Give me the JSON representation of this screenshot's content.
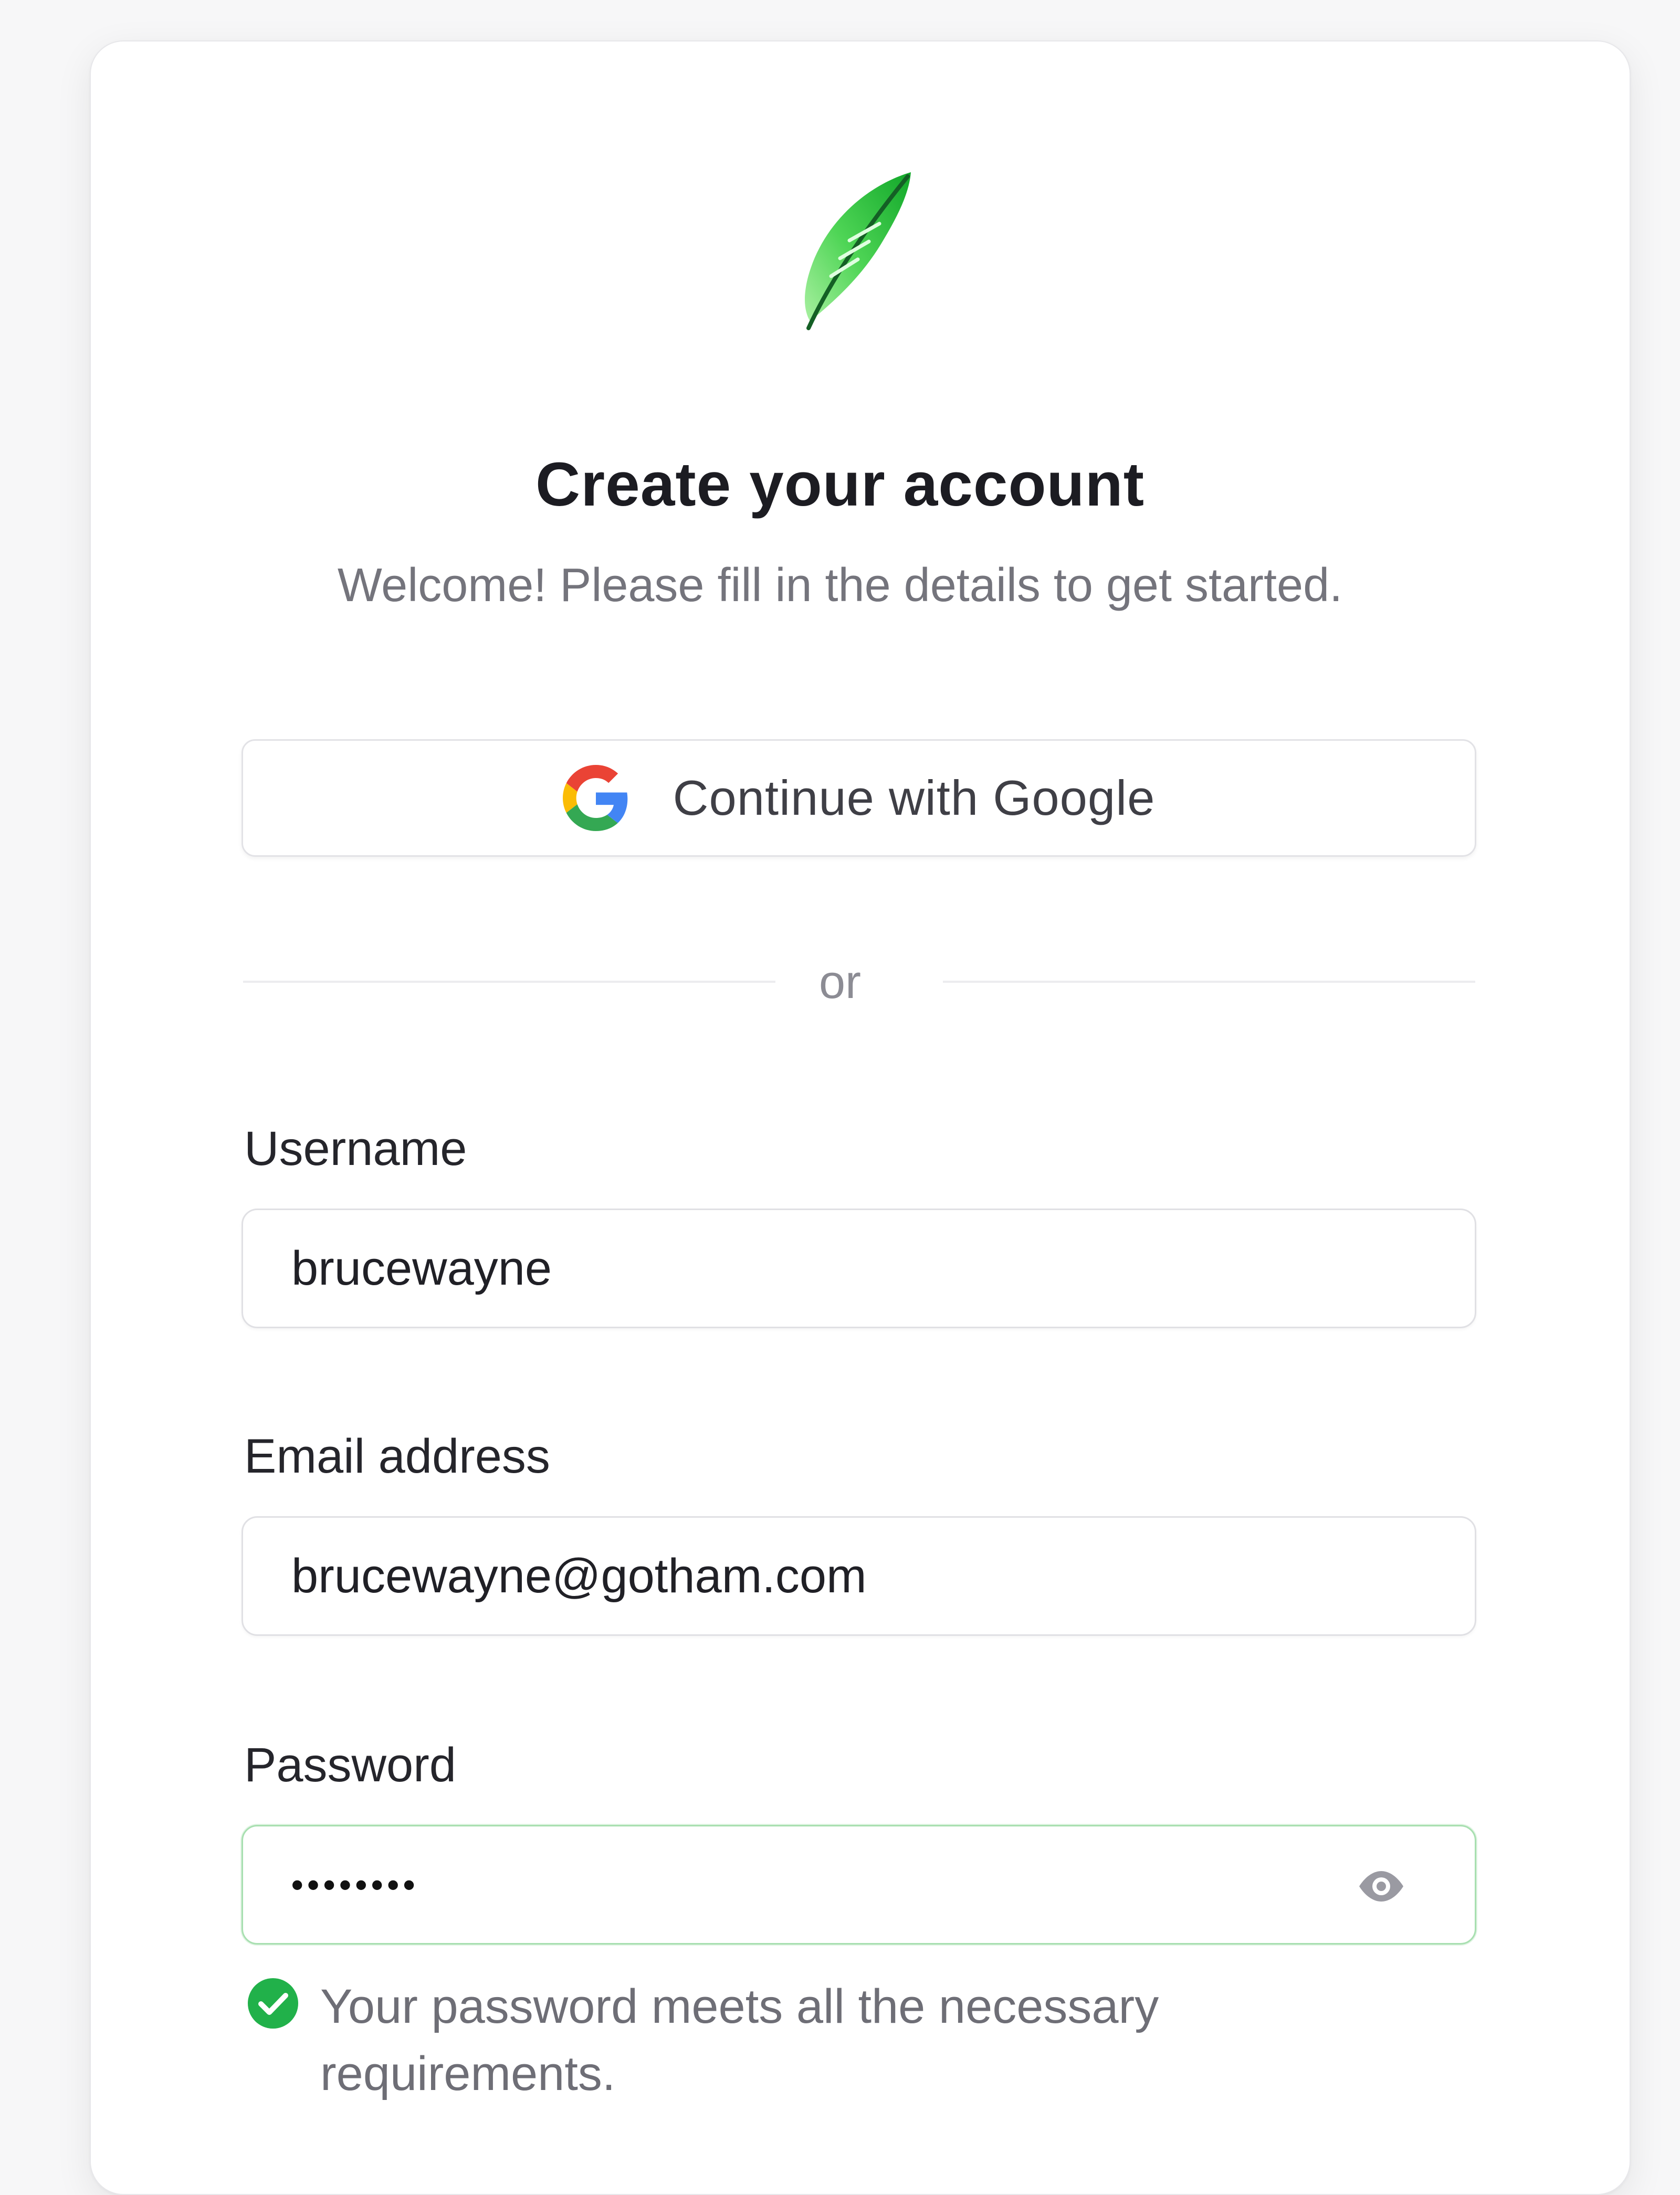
{
  "header": {
    "title": "Create your account",
    "subtitle": "Welcome! Please fill in the details to get started."
  },
  "logo": {
    "icon": "feather-icon",
    "color": "#4cd04e"
  },
  "social": {
    "google_label": "Continue with Google",
    "icon": "google-icon"
  },
  "divider": {
    "text": "or"
  },
  "form": {
    "username": {
      "label": "Username",
      "value": "brucewayne"
    },
    "email": {
      "label": "Email address",
      "value": "brucewayne@gotham.com"
    },
    "password": {
      "label": "Password",
      "value": "••••••••",
      "toggle_icon": "eye-icon",
      "status_color": "#21b14a",
      "hint": "Your password meets all the necessary requirements."
    }
  }
}
